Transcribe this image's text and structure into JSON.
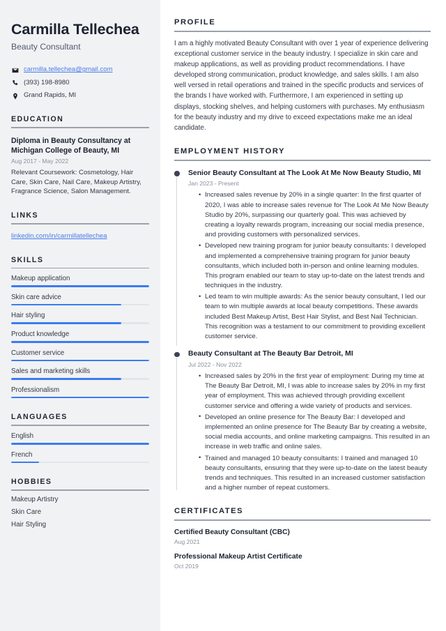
{
  "sidebar": {
    "name": "Carmilla Tellechea",
    "role": "Beauty Consultant",
    "contacts": [
      {
        "icon": "email-icon",
        "value": "carmilla.tellechea@gmail.com",
        "is_link": true
      },
      {
        "icon": "phone-icon",
        "value": "(393) 198-8980",
        "is_link": false
      },
      {
        "icon": "location-pin-icon",
        "value": "Grand Rapids, MI",
        "is_link": false
      }
    ],
    "education": {
      "heading": "EDUCATION",
      "entries": [
        {
          "title": "Diploma in Beauty Consultancy at Michigan College of Beauty, MI",
          "date": "Aug 2017 - May 2022",
          "description": "Relevant Coursework: Cosmetology, Hair Care, Skin Care, Nail Care, Makeup Artistry, Fragrance Science, Salon Management."
        }
      ]
    },
    "links": {
      "heading": "LINKS",
      "items": [
        {
          "label": "linkedin.com/in/carmillatellechea"
        }
      ]
    },
    "skills": {
      "heading": "SKILLS",
      "items": [
        {
          "label": "Makeup application",
          "level": 100
        },
        {
          "label": "Skin care advice",
          "level": 80
        },
        {
          "label": "Hair styling",
          "level": 80
        },
        {
          "label": "Product knowledge",
          "level": 100
        },
        {
          "label": "Customer service",
          "level": 100
        },
        {
          "label": "Sales and marketing skills",
          "level": 80
        },
        {
          "label": "Professionalism",
          "level": 100
        }
      ]
    },
    "languages": {
      "heading": "LANGUAGES",
      "items": [
        {
          "label": "English",
          "level": 100
        },
        {
          "label": "French",
          "level": 20
        }
      ]
    },
    "hobbies": {
      "heading": "HOBBIES",
      "items": [
        {
          "label": "Makeup Artistry"
        },
        {
          "label": "Skin Care"
        },
        {
          "label": "Hair Styling"
        }
      ]
    }
  },
  "main": {
    "profile": {
      "heading": "PROFILE",
      "text": "I am a highly motivated Beauty Consultant with over 1 year of experience delivering exceptional customer service in the beauty industry. I specialize in skin care and makeup applications, as well as providing product recommendations. I have developed strong communication, product knowledge, and sales skills. I am also well versed in retail operations and trained in the specific products and services of the brands I have worked with. Furthermore, I am experienced in setting up displays, stocking shelves, and helping customers with purchases. My enthusiasm for the beauty industry and my drive to exceed expectations make me an ideal candidate."
    },
    "employment": {
      "heading": "EMPLOYMENT HISTORY",
      "jobs": [
        {
          "title": "Senior Beauty Consultant at The Look At Me Now Beauty Studio, MI",
          "date": "Jan 2023 - Present",
          "bullets": [
            "Increased sales revenue by 20% in a single quarter: In the first quarter of 2020, I was able to increase sales revenue for The Look At Me Now Beauty Studio by 20%, surpassing our quarterly goal. This was achieved by creating a loyalty rewards program, increasing our social media presence, and providing customers with personalized services.",
            "Developed new training program for junior beauty consultants: I developed and implemented a comprehensive training program for junior beauty consultants, which included both in-person and online learning modules. This program enabled our team to stay up-to-date on the latest trends and techniques in the industry.",
            "Led team to win multiple awards: As the senior beauty consultant, I led our team to win multiple awards at local beauty competitions. These awards included Best Makeup Artist, Best Hair Stylist, and Best Nail Technician. This recognition was a testament to our commitment to providing excellent customer service."
          ]
        },
        {
          "title": "Beauty Consultant at The Beauty Bar Detroit, MI",
          "date": "Jul 2022 - Nov 2022",
          "bullets": [
            "Increased sales by 20% in the first year of employment: During my time at The Beauty Bar Detroit, MI, I was able to increase sales by 20% in my first year of employment. This was achieved through providing excellent customer service and offering a wide variety of products and services.",
            "Developed an online presence for The Beauty Bar: I developed and implemented an online presence for The Beauty Bar by creating a website, social media accounts, and online marketing campaigns. This resulted in an increase in web traffic and online sales.",
            "Trained and managed 10 beauty consultants: I trained and managed 10 beauty consultants, ensuring that they were up-to-date on the latest beauty trends and techniques. This resulted in an increased customer satisfaction and a higher number of repeat customers."
          ]
        }
      ]
    },
    "certificates": {
      "heading": "CERTIFICATES",
      "items": [
        {
          "title": "Certified Beauty Consultant (CBC)",
          "date": "Aug 2021"
        },
        {
          "title": "Professional Makeup Artist Certificate",
          "date": "Oct 2019"
        }
      ]
    }
  },
  "colors": {
    "accent": "#3b7cf0",
    "link": "#4a7dea",
    "sidebar_bg": "#f1f2f4",
    "heading": "#202633",
    "body_text": "#333946",
    "muted": "#8b909b"
  }
}
